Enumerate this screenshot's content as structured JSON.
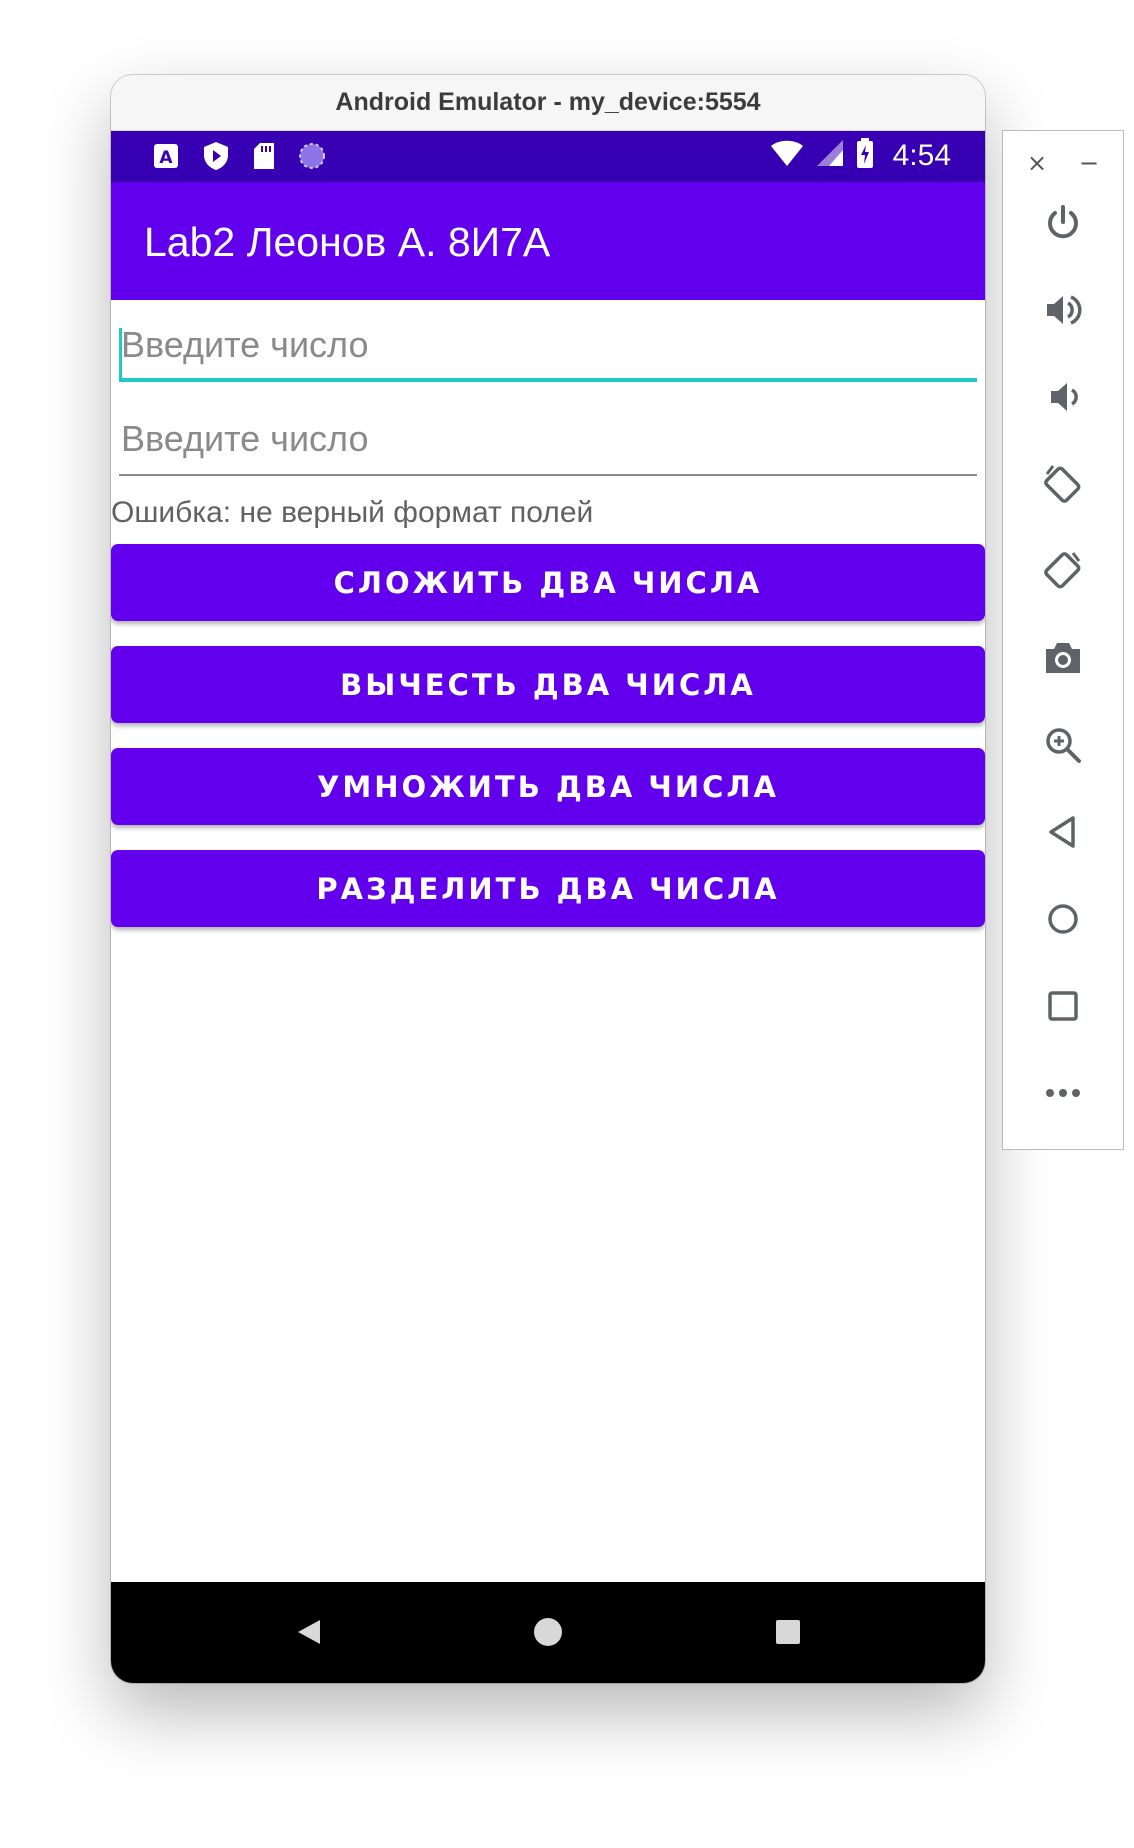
{
  "window": {
    "title": "Android Emulator - my_device:5554"
  },
  "status_bar": {
    "time": "4:54",
    "left_icons": [
      "text-a-icon",
      "shield-play-icon",
      "sd-card-icon",
      "loading-circle-icon"
    ],
    "right_icons": [
      "wifi-icon",
      "cell-signal-icon",
      "battery-charging-icon"
    ]
  },
  "app": {
    "title": "Lab2 Леонов А. 8И7А",
    "field1": {
      "placeholder": "Введите число",
      "value": ""
    },
    "field2": {
      "placeholder": "Введите число",
      "value": ""
    },
    "error_text": "Ошибка: не верный формат полей",
    "buttons": {
      "add": "СЛОЖИТЬ ДВА ЧИСЛА",
      "subtract": "ВЫЧЕСТЬ ДВА ЧИСЛА",
      "multiply": "УМНОЖИТЬ ДВА ЧИСЛА",
      "divide": "РАЗДЕЛИТЬ ДВА ЧИСЛА"
    }
  },
  "nav_bar": {
    "icons": [
      "back-icon",
      "home-icon",
      "recents-icon"
    ]
  },
  "side_toolbar": {
    "window_controls": {
      "close": "×",
      "minimize": "−"
    },
    "tools": [
      "power-icon",
      "volume-up-icon",
      "volume-down-icon",
      "rotate-left-icon",
      "rotate-right-icon",
      "camera-icon",
      "zoom-icon",
      "back-icon",
      "home-icon",
      "overview-icon",
      "more-icon"
    ]
  },
  "colors": {
    "primary": "#6200ee",
    "primary_dark": "#3700b3",
    "accent": "#1ecbc0",
    "error_text": "#616161"
  }
}
